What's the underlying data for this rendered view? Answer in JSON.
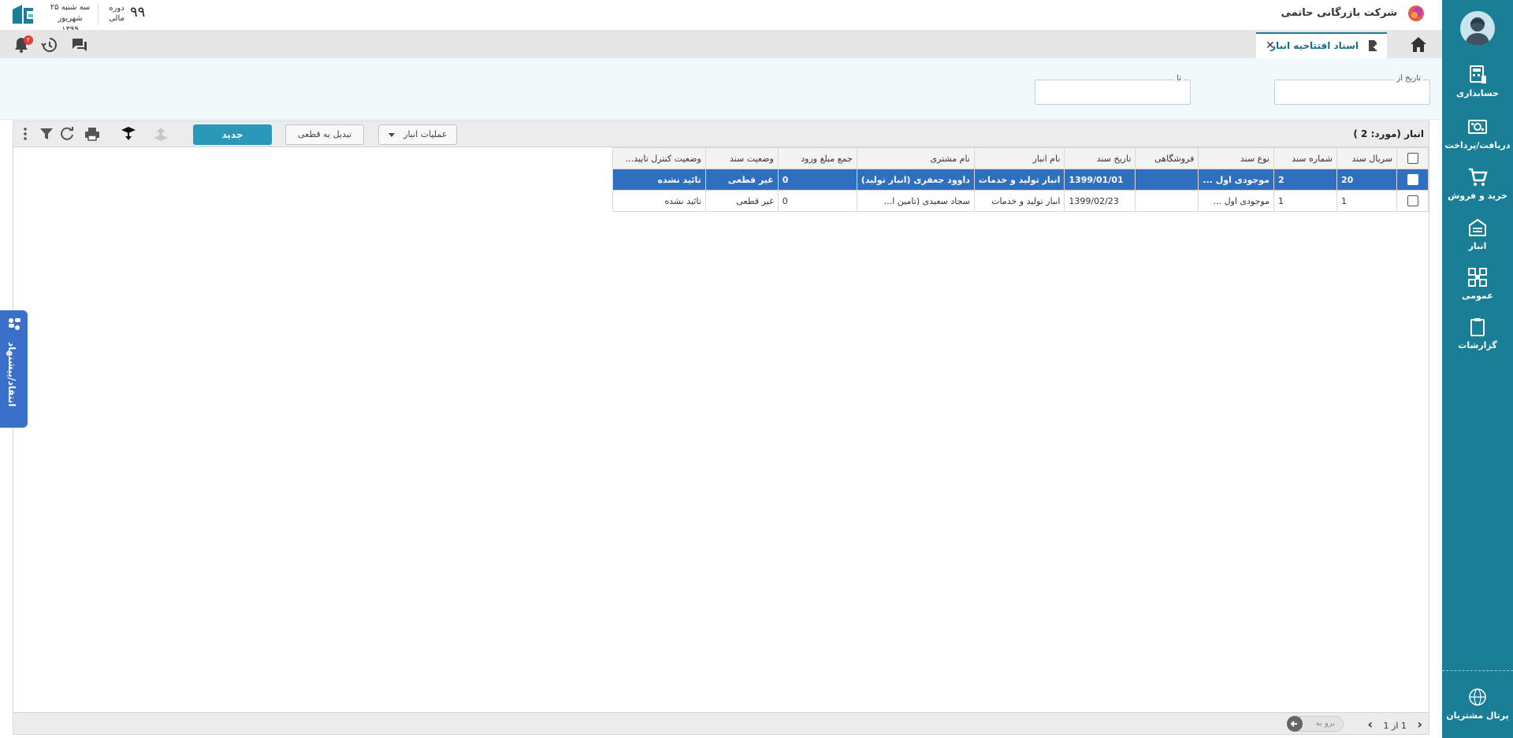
{
  "sidebar": {
    "items": [
      {
        "label": "حسابداری",
        "icon": "calculator-icon"
      },
      {
        "label": "دریافت/پرداخت",
        "icon": "cash-icon"
      },
      {
        "label": "خرید و فروش",
        "icon": "cart-icon"
      },
      {
        "label": "انبار",
        "icon": "warehouse-icon"
      },
      {
        "label": "عمومی",
        "icon": "grid-icon"
      },
      {
        "label": "گزارشات",
        "icon": "clipboard-icon"
      }
    ],
    "portal_label": "پرتال مشتریان"
  },
  "header": {
    "company": "شرکت بازرگانی حاتمی",
    "date_line1": "سه شنبه ۲۵",
    "date_line2": "شهریور ۱۳۹۹",
    "period_label_1": "دوره",
    "period_label_2": "مالی",
    "period_value": "۹۹",
    "notification_count": "۲"
  },
  "tabs": {
    "active_title": "اسناد افتتاحیه انبار",
    "close_symbol": "✕"
  },
  "filters": {
    "date_from_label": "تاریخ از",
    "date_to_label": "تا",
    "date_from_value": "",
    "date_to_value": ""
  },
  "grid": {
    "title": "انبار (مورد: 2 )",
    "new_button": "جدید",
    "convert_button": "تبدیل به قطعی",
    "operations_button": "عملیات انبار",
    "columns": [
      "سریال سند",
      "شماره سند",
      "نوع سند",
      "فروشگاهی",
      "تاریخ سند",
      "نام انبار",
      "نام مشتری",
      "جمع مبلغ ورود",
      "وضعیت سند",
      "وضعیت کنترل تایید..."
    ],
    "rows": [
      {
        "serial": "20",
        "number": "2",
        "type": "موجودی اول ...",
        "store": "",
        "date": "1399/01/01",
        "warehouse": "انبار تولید و خدمات",
        "customer": "داوود جعفری (انبار تولید)",
        "amount": "0",
        "status": "غیر قطعی",
        "control": "تائید نشده"
      },
      {
        "serial": "1",
        "number": "1",
        "type": "موجودی اول ...",
        "store": "",
        "date": "1399/02/23",
        "warehouse": "انبار تولید و خدمات",
        "customer": "سجاد سعیدی (تامین ا...",
        "amount": "0",
        "status": "غیر قطعی",
        "control": "تائید نشده"
      }
    ]
  },
  "pager": {
    "text": "1 از 1",
    "goto_placeholder": "برو به"
  },
  "feedback": {
    "label": "انتقاد/پیشنهاد"
  },
  "colors": {
    "sidebar": "#1a7f96",
    "selected_row": "#2f6fbf",
    "new_button": "#2a98b8"
  }
}
